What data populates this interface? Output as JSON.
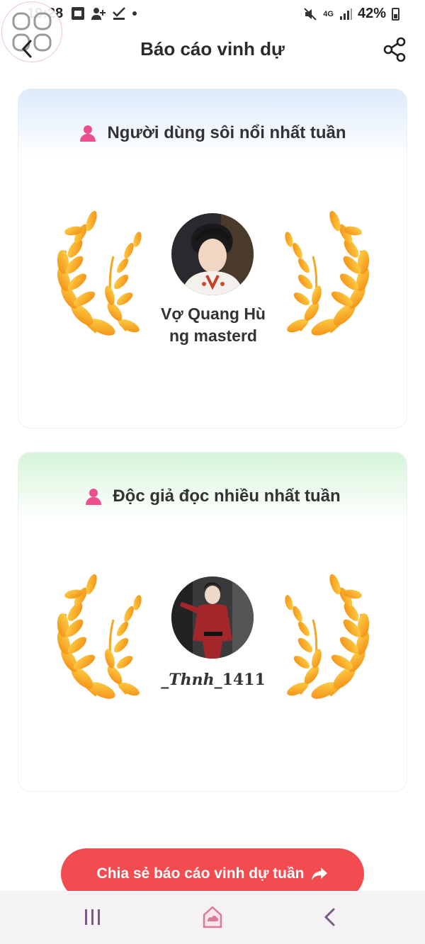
{
  "status_bar": {
    "time": "19:28",
    "battery": "42%",
    "network": "4G"
  },
  "header": {
    "title": "Báo cáo vinh dự"
  },
  "cards": [
    {
      "title": "Người dùng sôi nổi nhất tuần",
      "user_name_line1": "Vợ Quang Hù",
      "user_name_line2": "ng masterd"
    },
    {
      "title": "Độc giả đọc nhiều nhất tuần",
      "user_name_italic": "_Thnh",
      "user_name_rest": "_1411"
    }
  ],
  "cta": {
    "label": "Chia sẻ báo cáo vinh dự tuần"
  },
  "colors": {
    "accent": "#f24b50",
    "gold": "#f5a623",
    "pink_icon": "#ec4f8e"
  }
}
